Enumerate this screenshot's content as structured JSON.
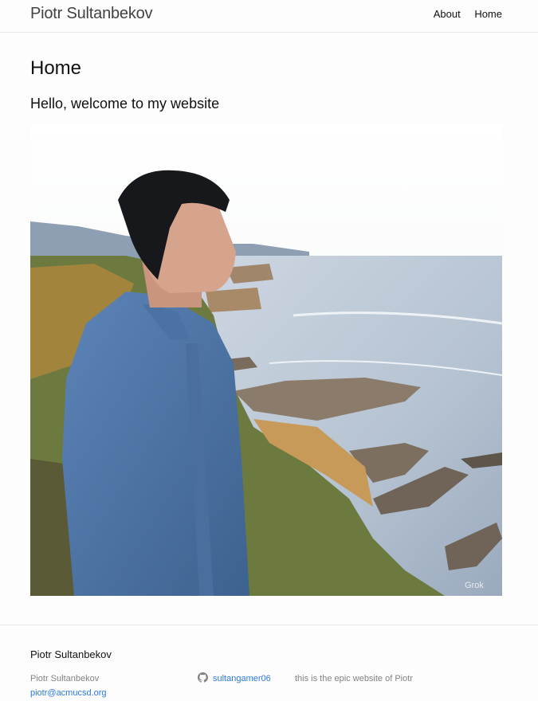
{
  "header": {
    "site_title": "Piotr Sultanbekov",
    "nav": [
      {
        "label": "About"
      },
      {
        "label": "Home"
      }
    ]
  },
  "main": {
    "page_title": "Home",
    "intro": "Hello, welcome to my website",
    "image": {
      "subject": "portrait-coastal-cliff",
      "watermark": "Grok"
    }
  },
  "footer": {
    "heading": "Piotr Sultanbekov",
    "name": "Piotr Sultanbekov",
    "email": "piotr@acmucsd.org",
    "github_icon": "github-icon",
    "github_username": "sultangamer06",
    "description": "this is the epic website of Piotr"
  },
  "colors": {
    "link": "#2a7ae2",
    "muted": "#828282",
    "border": "#e8e8e8",
    "background": "#fdfdfd"
  }
}
